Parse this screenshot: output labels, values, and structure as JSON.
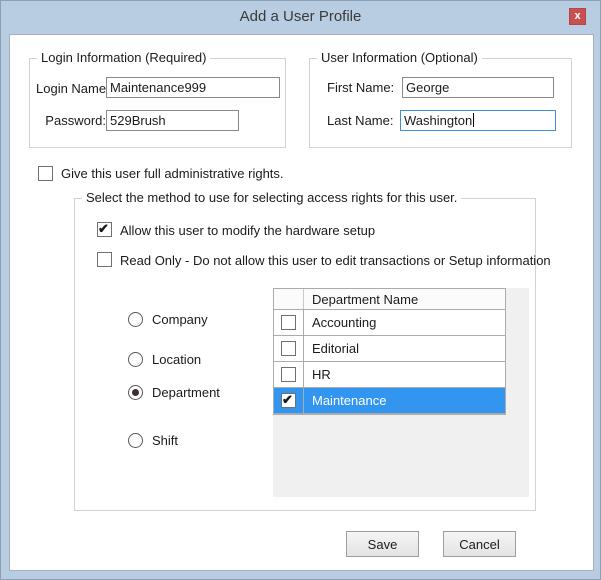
{
  "window": {
    "title": "Add a User Profile",
    "close_label": "x"
  },
  "login_section": {
    "legend": "Login Information (Required)",
    "login_name_label": "Login Name:",
    "login_name_value": "Maintenance999",
    "password_label": "Password:",
    "password_value": "529Brush"
  },
  "user_section": {
    "legend": "User Information (Optional)",
    "first_name_label": "First Name:",
    "first_name_value": "George",
    "last_name_label": "Last Name:",
    "last_name_value": "Washington"
  },
  "admin_checkbox": {
    "label": "Give this user full administrative rights.",
    "checked": false
  },
  "access_section": {
    "legend": "Select the method to use for selecting access rights for this user.",
    "hardware_checkbox": {
      "label": "Allow this user to modify the hardware setup",
      "checked": true
    },
    "readonly_checkbox": {
      "label": "Read Only - Do not allow this user to edit transactions or Setup information",
      "checked": false
    },
    "method_options": [
      {
        "label": "Company",
        "selected": false
      },
      {
        "label": "Location",
        "selected": false
      },
      {
        "label": "Department",
        "selected": true
      },
      {
        "label": "Shift",
        "selected": false
      }
    ],
    "grid": {
      "header": "Department Name",
      "rows": [
        {
          "name": "Accounting",
          "checked": false,
          "selected": false
        },
        {
          "name": "Editorial",
          "checked": false,
          "selected": false
        },
        {
          "name": "HR",
          "checked": false,
          "selected": false
        },
        {
          "name": "Maintenance",
          "checked": true,
          "selected": true
        }
      ]
    }
  },
  "buttons": {
    "save": "Save",
    "cancel": "Cancel"
  },
  "colors": {
    "titlebar": "#b9cde2",
    "close_button": "#c75050",
    "selected_row": "#3296f1",
    "focus_border": "#3d8fd6"
  }
}
